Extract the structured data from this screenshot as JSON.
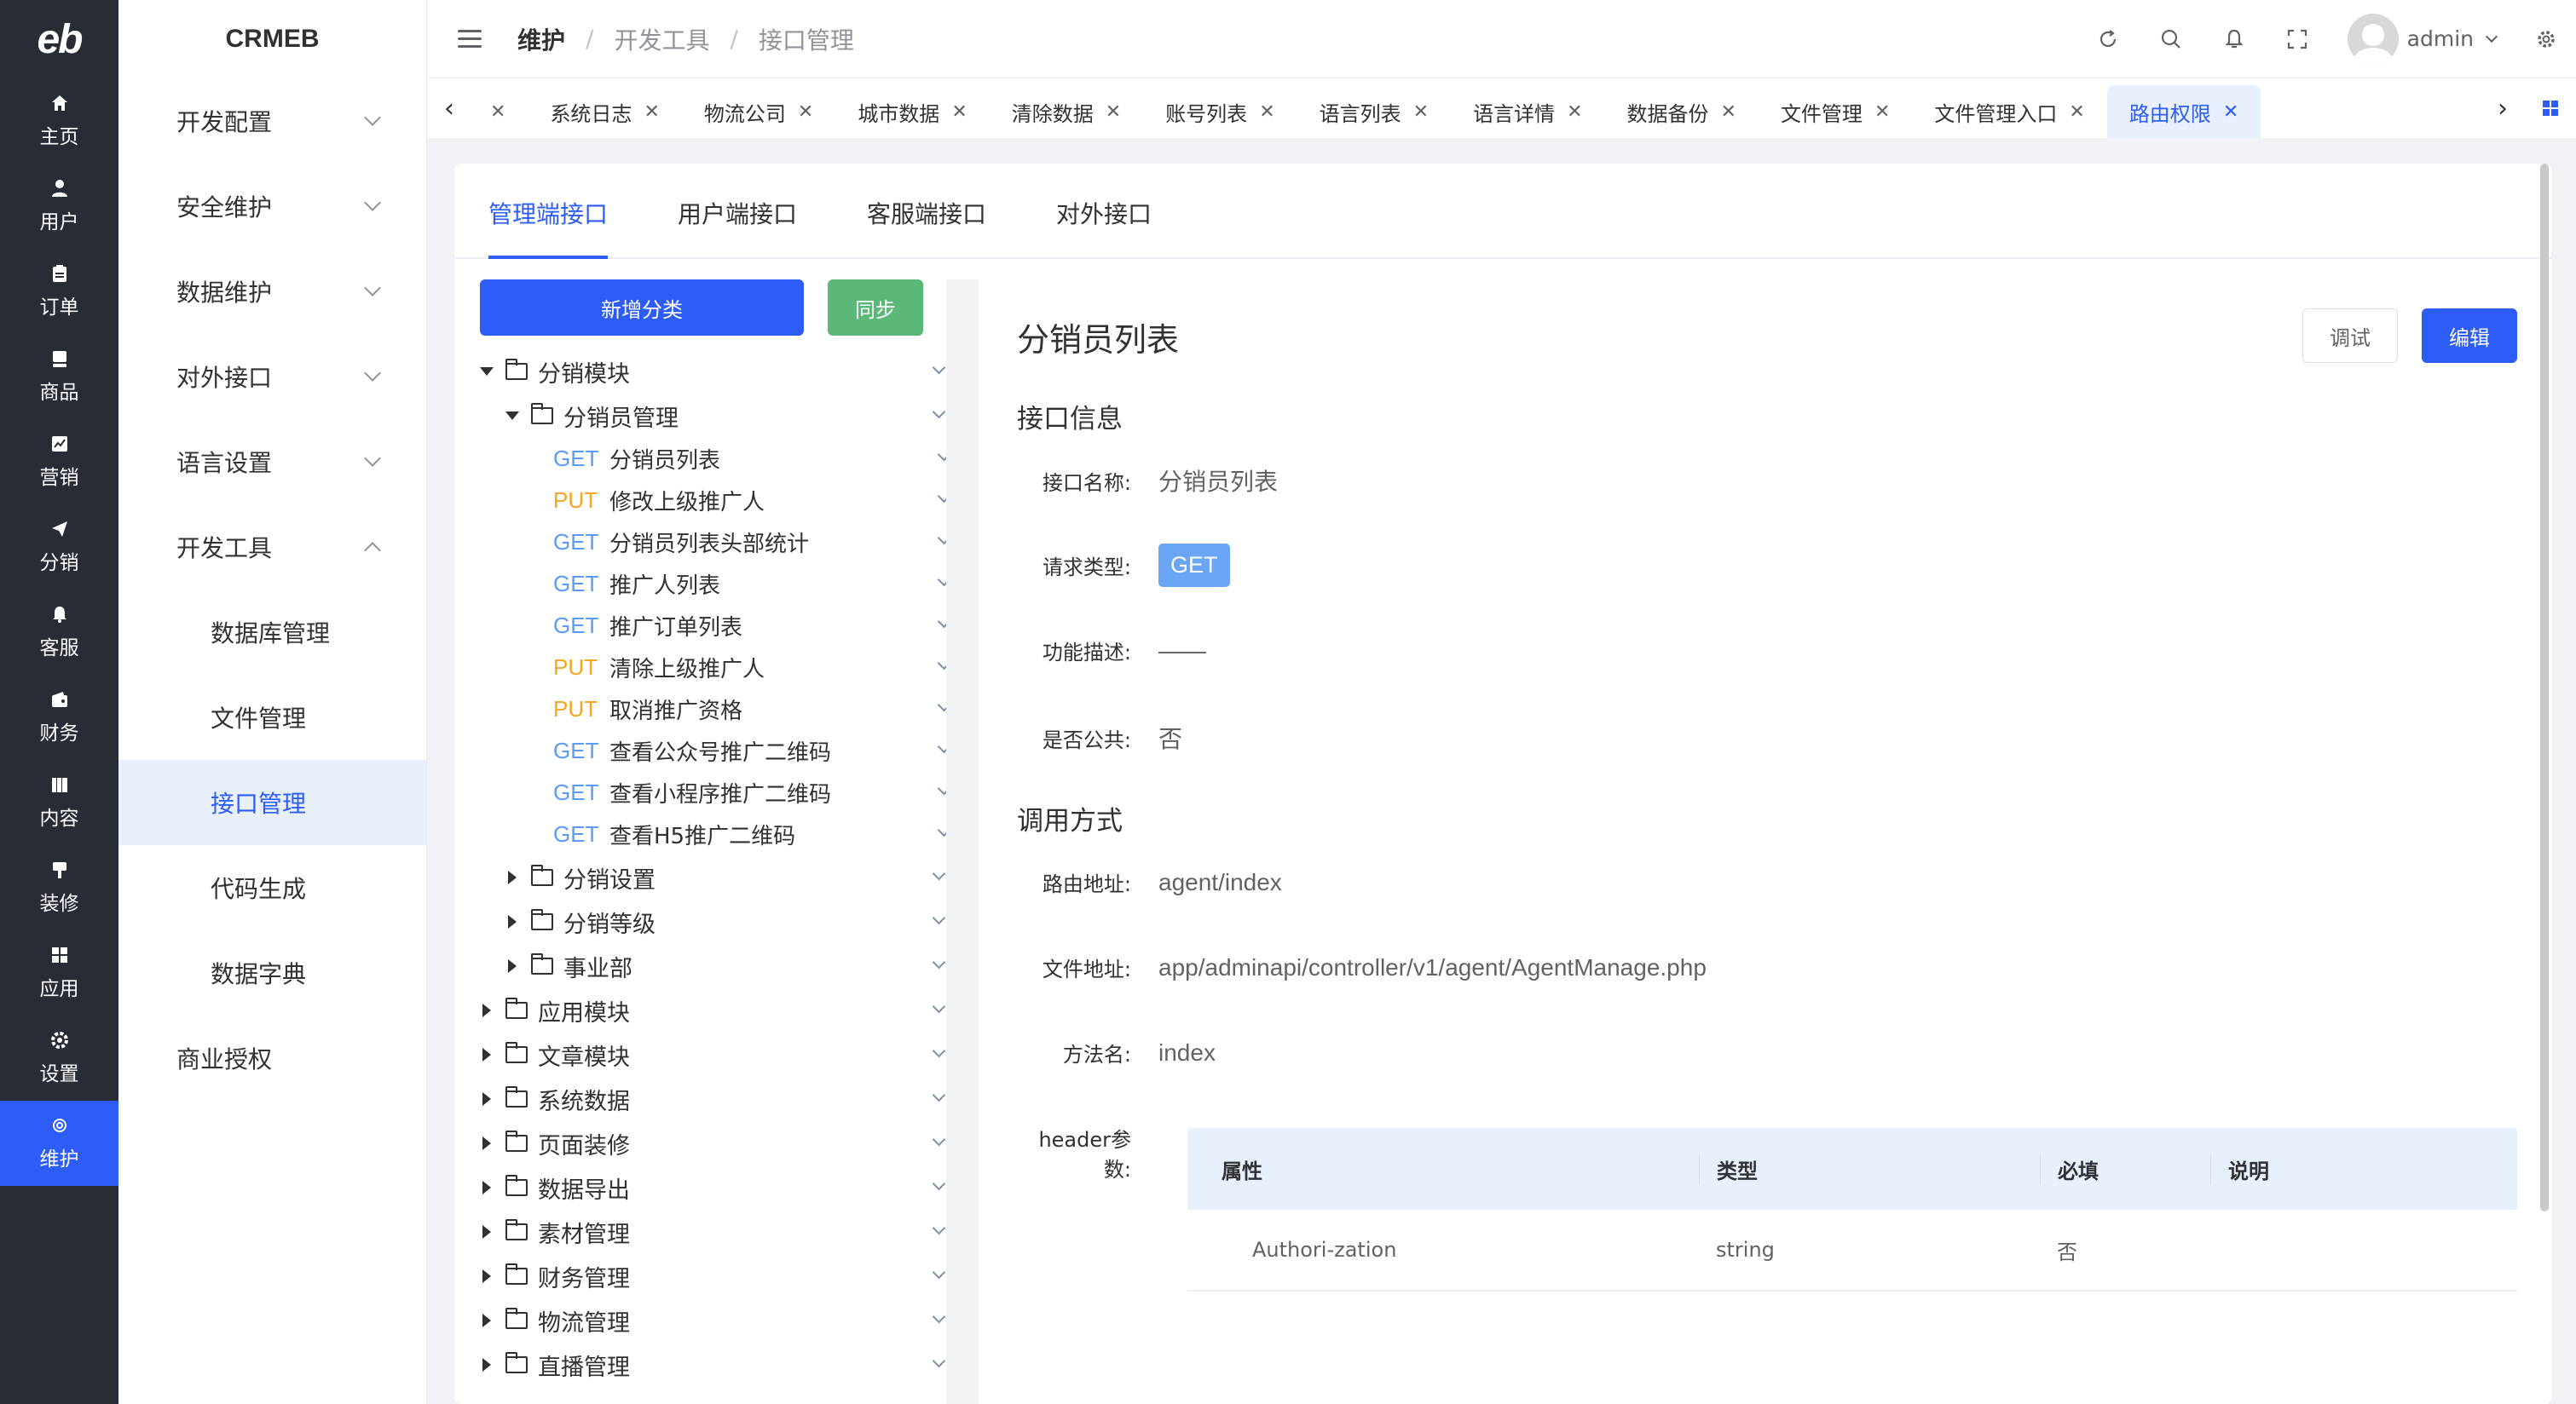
{
  "rail": {
    "logo": "eb",
    "items": [
      {
        "label": "主页",
        "icon": "home-icon"
      },
      {
        "label": "用户",
        "icon": "user-icon"
      },
      {
        "label": "订单",
        "icon": "order-icon"
      },
      {
        "label": "商品",
        "icon": "product-icon"
      },
      {
        "label": "营销",
        "icon": "marketing-icon"
      },
      {
        "label": "分销",
        "icon": "send-icon"
      },
      {
        "label": "客服",
        "icon": "bell-icon"
      },
      {
        "label": "财务",
        "icon": "wallet-icon"
      },
      {
        "label": "内容",
        "icon": "book-icon"
      },
      {
        "label": "装修",
        "icon": "brush-icon"
      },
      {
        "label": "应用",
        "icon": "apps-icon"
      },
      {
        "label": "设置",
        "icon": "settings-icon"
      },
      {
        "label": "维护",
        "icon": "maintenance-icon"
      }
    ]
  },
  "submenu": {
    "brand": "CRMEB",
    "items": [
      {
        "label": "开发配置"
      },
      {
        "label": "安全维护"
      },
      {
        "label": "数据维护"
      },
      {
        "label": "对外接口"
      },
      {
        "label": "语言设置"
      },
      {
        "label": "开发工具"
      },
      {
        "label": "数据库管理"
      },
      {
        "label": "文件管理"
      },
      {
        "label": "接口管理"
      },
      {
        "label": "代码生成"
      },
      {
        "label": "数据字典"
      },
      {
        "label": "商业授权"
      }
    ]
  },
  "header": {
    "breadcrumb": [
      "维护",
      "开发工具",
      "接口管理"
    ],
    "user": "admin"
  },
  "tabs": [
    "系统日志",
    "物流公司",
    "城市数据",
    "清除数据",
    "账号列表",
    "语言列表",
    "语言详情",
    "数据备份",
    "文件管理",
    "文件管理入口",
    "路由权限"
  ],
  "card_tabs": [
    "管理端接口",
    "用户端接口",
    "客服端接口",
    "对外接口"
  ],
  "tree": {
    "add_button": "新增分类",
    "sync_button": "同步",
    "root1": "分销模块",
    "group1": "分销员管理",
    "apis": [
      {
        "method": "GET",
        "name": "分销员列表"
      },
      {
        "method": "PUT",
        "name": "修改上级推广人"
      },
      {
        "method": "GET",
        "name": "分销员列表头部统计"
      },
      {
        "method": "GET",
        "name": "推广人列表"
      },
      {
        "method": "GET",
        "name": "推广订单列表"
      },
      {
        "method": "PUT",
        "name": "清除上级推广人"
      },
      {
        "method": "PUT",
        "name": "取消推广资格"
      },
      {
        "method": "GET",
        "name": "查看公众号推广二维码"
      },
      {
        "method": "GET",
        "name": "查看小程序推广二维码"
      },
      {
        "method": "GET",
        "name": "查看H5推广二维码"
      }
    ],
    "sub_groups": [
      "分销设置",
      "分销等级",
      "事业部"
    ],
    "roots": [
      "应用模块",
      "文章模块",
      "系统数据",
      "页面装修",
      "数据导出",
      "素材管理",
      "财务管理",
      "物流管理",
      "直播管理"
    ]
  },
  "detail": {
    "title": "分销员列表",
    "debug_button": "调试",
    "edit_button": "编辑",
    "info_section": "接口信息",
    "call_section": "调用方式",
    "name_label": "接口名称:",
    "name_value": "分销员列表",
    "type_label": "请求类型:",
    "type_value": "GET",
    "desc_label": "功能描述:",
    "desc_value": "——",
    "public_label": "是否公共:",
    "public_value": "否",
    "route_label": "路由地址:",
    "route_value": "agent/index",
    "file_label": "文件地址:",
    "file_value": "app/adminapi/controller/v1/agent/AgentManage.php",
    "method_label": "方法名:",
    "method_value": "index",
    "header_label": "header参数:",
    "table": {
      "headers": [
        "属性",
        "类型",
        "必填",
        "说明"
      ],
      "rows": [
        [
          "Authori-zation",
          "string",
          "否",
          ""
        ]
      ]
    }
  },
  "colors": {
    "accent": "#2d5cf6",
    "rail": "#282c34",
    "get": "#5b9bf8",
    "put": "#f5a623",
    "success": "#5cb878"
  }
}
